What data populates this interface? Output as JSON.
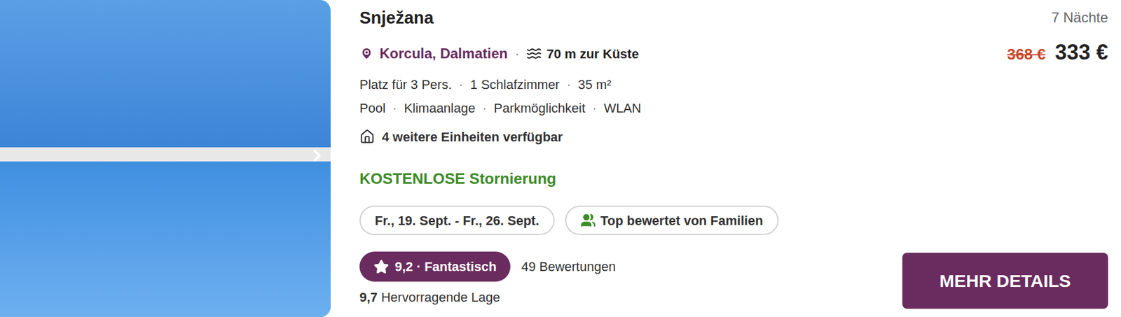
{
  "listing": {
    "title": "Snježana",
    "location": "Korcula, Dalmatien",
    "separator": "·",
    "coast": "70 m zur Küste",
    "details": [
      "Platz für 3 Pers.",
      "1 Schlafzimmer",
      "35 m²"
    ],
    "amenities": [
      "Pool",
      "Klimaanlage",
      "Parkmöglichkeit",
      "WLAN"
    ],
    "more_units": "4 weitere Einheiten verfügbar",
    "cancellation": "KOSTENLOSE Stornierung",
    "chips": [
      {
        "label": "Fr., 19. Sept. - Fr., 26. Sept.",
        "kind": "dates"
      },
      {
        "label": "Top bewertet von Familien",
        "kind": "family"
      }
    ],
    "rating": {
      "badge": "9,2 · Fantastisch",
      "reviews": "49 Bewertungen"
    },
    "location_rating": {
      "score": "9,7",
      "label": "Hervorragende Lage"
    }
  },
  "price": {
    "nights": "7 Nächte",
    "old": "368 €",
    "current": "333 €"
  },
  "button": "MEHR DETAILS"
}
